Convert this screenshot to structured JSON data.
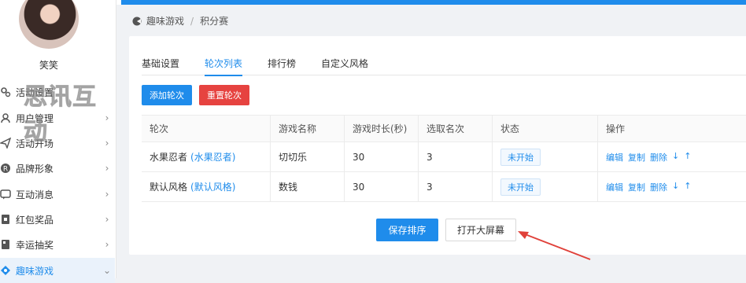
{
  "sidebar": {
    "username": "笑笑",
    "watermark": "思讯互动",
    "items": [
      {
        "label": "活动设置",
        "icon": "gears-icon"
      },
      {
        "label": "用户管理",
        "icon": "user-icon"
      },
      {
        "label": "活动开场",
        "icon": "paper-plane-icon"
      },
      {
        "label": "品牌形象",
        "icon": "registered-icon"
      },
      {
        "label": "互动消息",
        "icon": "message-icon"
      },
      {
        "label": "红包奖品",
        "icon": "gift-icon"
      },
      {
        "label": "幸运抽奖",
        "icon": "lottery-icon"
      },
      {
        "label": "趣味游戏",
        "icon": "game-icon"
      }
    ]
  },
  "breadcrumb": {
    "root": "趣味游戏",
    "sep": "/",
    "current": "积分赛"
  },
  "tabs": [
    "基础设置",
    "轮次列表",
    "排行榜",
    "自定义风格"
  ],
  "actions": {
    "add": "添加轮次",
    "reset": "重置轮次"
  },
  "table": {
    "headers": [
      "轮次",
      "游戏名称",
      "游戏时长(秒)",
      "选取名次",
      "状态",
      "操作"
    ],
    "rows": [
      {
        "round": "水果忍者",
        "style": "(水果忍者)",
        "game": "切切乐",
        "duration": "30",
        "rank": "3",
        "status": "未开始"
      },
      {
        "round": "默认风格",
        "style": "(默认风格)",
        "game": "数钱",
        "duration": "30",
        "rank": "3",
        "status": "未开始"
      }
    ],
    "ops": [
      "编辑",
      "复制",
      "删除",
      "↓",
      "↑"
    ]
  },
  "footer": {
    "save": "保存排序",
    "screen": "打开大屏幕"
  },
  "colors": {
    "primary": "#1f8ceb",
    "danger": "#e64340",
    "arrow": "#e0413a"
  }
}
